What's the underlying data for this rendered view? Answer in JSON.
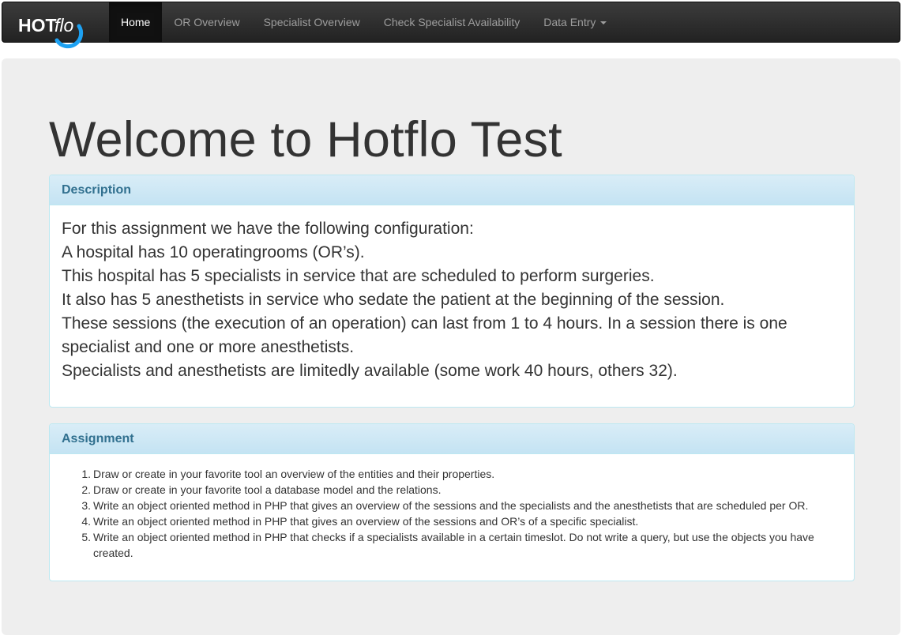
{
  "app": {
    "brand": {
      "strong": "HOT",
      "light": "flo"
    },
    "accent_color": "#1da1f2"
  },
  "nav": {
    "items": [
      {
        "label": "Home",
        "active": true
      },
      {
        "label": "OR Overview"
      },
      {
        "label": "Specialist Overview"
      },
      {
        "label": "Check Specialist Availability"
      },
      {
        "label": "Data Entry"
      }
    ]
  },
  "page": {
    "title": "Welcome to Hotflo Test"
  },
  "description": {
    "heading": "Description",
    "lines": [
      "For this assignment we have the following configuration:",
      "A hospital has 10 operatingrooms (OR’s).",
      "This hospital has 5 specialists in service that are scheduled to perform surgeries.",
      "It also has 5 anesthetists in service who sedate the patient at the beginning of the session.",
      "These sessions (the execution of an operation) can last from 1 to 4 hours. In a session there is one",
      "specialist and one or more anesthetists.",
      "Specialists and anesthetists are limitedly available (some work 40 hours, others 32)."
    ]
  },
  "assignment": {
    "heading": "Assignment",
    "items": [
      {
        "num": "1.",
        "text": "Draw or create in your favorite tool an overview of the entities and their properties."
      },
      {
        "num": "2.",
        "text": "Draw or create in your favorite tool a database model and the relations."
      },
      {
        "num": "3.",
        "text": "Write an object oriented method in PHP that gives an overview of the sessions and the specialists and the anesthetists that are scheduled per OR."
      },
      {
        "num": "4.",
        "text": "Write an object oriented method in PHP that gives an overview of the sessions and OR’s of a specific specialist."
      },
      {
        "num": "5.",
        "text": "Write an object oriented method in PHP that checks if a specialists available in a certain timeslot. Do not write a query, but use the objects you have created."
      }
    ]
  }
}
